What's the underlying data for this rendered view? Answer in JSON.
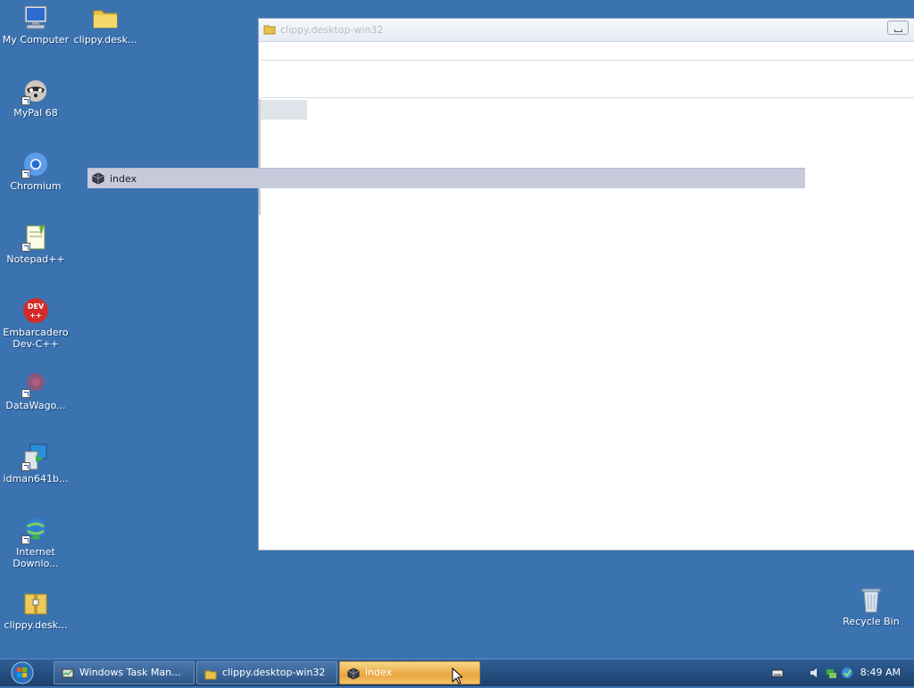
{
  "desktop": {
    "icons": [
      {
        "id": "my-computer",
        "label": "My Computer"
      },
      {
        "id": "clippy-folder",
        "label": "clippy.desk..."
      },
      {
        "id": "mypal",
        "label": "MyPal 68"
      },
      {
        "id": "chromium",
        "label": "Chromium"
      },
      {
        "id": "notepadpp",
        "label": "Notepad++"
      },
      {
        "id": "devcpp",
        "label": "Embarcadero Dev-C++"
      },
      {
        "id": "datawago",
        "label": "DataWago..."
      },
      {
        "id": "idman",
        "label": "idman641b..."
      },
      {
        "id": "idm",
        "label": "Internet Downlo..."
      },
      {
        "id": "clippy-zip",
        "label": "clippy.desk..."
      },
      {
        "id": "recycle-bin",
        "label": "Recycle Bin"
      }
    ]
  },
  "explorer": {
    "title": "clippy.desktop-win32"
  },
  "drag_ghost": {
    "label": "index"
  },
  "taskbar": {
    "buttons": [
      {
        "label": "Windows Task Man...",
        "icon": "task-manager-icon",
        "active": false
      },
      {
        "label": "clippy.desktop-win32",
        "icon": "folder-icon",
        "active": false
      },
      {
        "label": "index",
        "icon": "app-cube-icon",
        "active": true
      }
    ],
    "clock": "8:49 AM"
  },
  "colors": {
    "desktop": "#3b73b1",
    "taskbar": "#1c3f6a",
    "active_button": "#eaa43c"
  }
}
